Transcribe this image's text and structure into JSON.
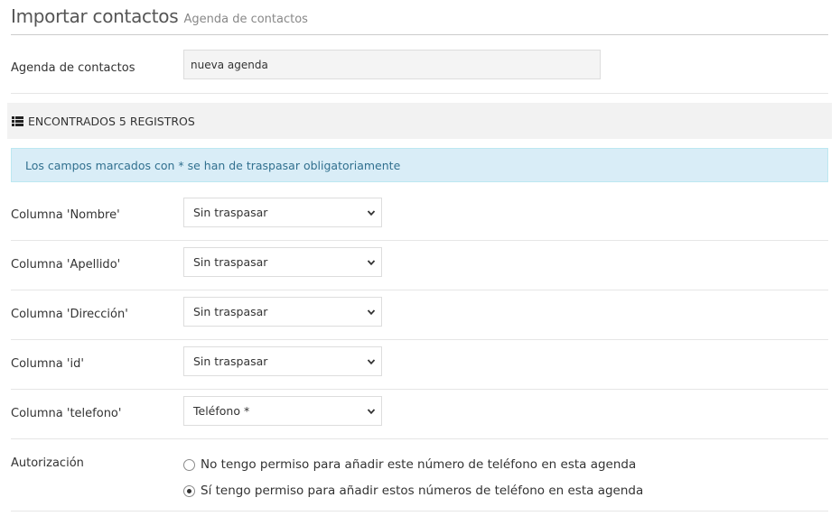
{
  "header": {
    "title": "Importar contactos",
    "subtitle": "Agenda de contactos"
  },
  "agenda": {
    "label": "Agenda de contactos",
    "value": "nueva agenda"
  },
  "section": {
    "icon": "list-icon",
    "title": "ENCONTRADOS 5 REGISTROS"
  },
  "info": {
    "message": "Los campos marcados con * se han de traspasar obligatoriamente"
  },
  "columns": [
    {
      "label": "Columna 'Nombre'",
      "selected": "Sin traspasar"
    },
    {
      "label": "Columna 'Apellido'",
      "selected": "Sin traspasar"
    },
    {
      "label": "Columna 'Dirección'",
      "selected": "Sin traspasar"
    },
    {
      "label": "Columna 'id'",
      "selected": "Sin traspasar"
    },
    {
      "label": "Columna 'telefono'",
      "selected": "Teléfono *"
    }
  ],
  "authorization": {
    "label": "Autorización",
    "options": [
      {
        "label": "No tengo permiso para añadir este número de teléfono en esta agenda",
        "checked": false
      },
      {
        "label": "Sí tengo permiso para añadir estos números de teléfono en esta agenda",
        "checked": true
      }
    ]
  },
  "colors": {
    "info_bg": "#d9edf7",
    "info_text": "#31708f",
    "section_bg": "#f2f2f2"
  }
}
